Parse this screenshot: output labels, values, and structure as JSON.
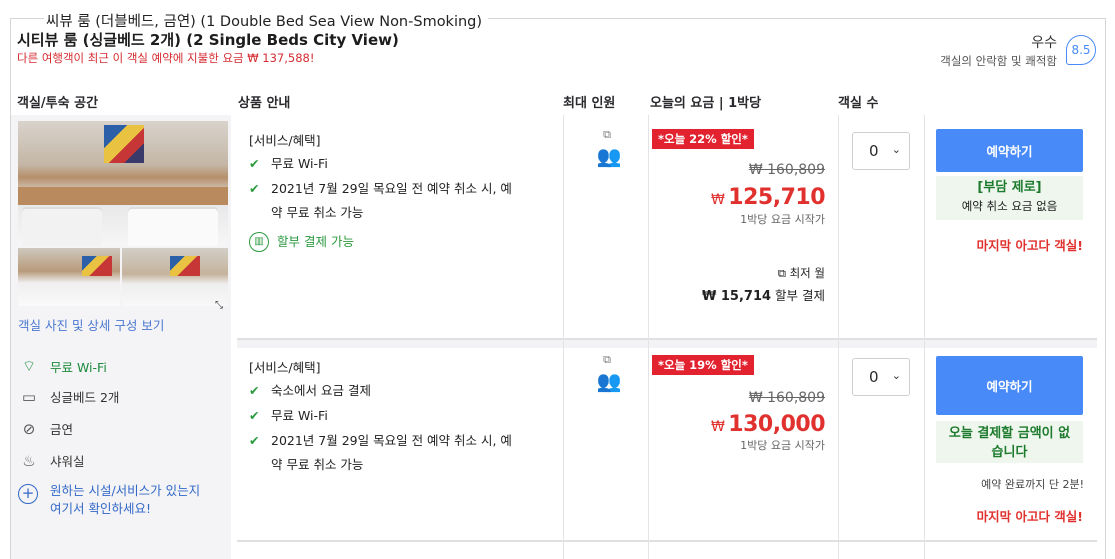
{
  "prev_room_title": "씨뷰 룸 (더블베드, 금연) (1 Double Bed Sea View Non-Smoking)",
  "room": {
    "title": "시티뷰 룸 (싱글베드 2개) (2 Single Beds City View)",
    "warning": "다른 여행객이 최근 이 객실 예약에 지불한 요금 ₩ 137,588!",
    "rating": {
      "word": "우수",
      "sub": "객실의 안락함 및 쾌적함",
      "score": "8.5"
    }
  },
  "headers": {
    "room_space": "객실/투숙 공간",
    "product": "상품 안내",
    "max_guests": "최대 인원",
    "price": "오늘의 요금 | 1박당",
    "rooms": "객실 수"
  },
  "left": {
    "photo_link": "객실 사진 및 상세 구성 보기",
    "amenities": [
      {
        "icon": "wifi-icon",
        "label": "무료 Wi-Fi"
      },
      {
        "icon": "bed-icon",
        "label": "싱글베드 2개"
      },
      {
        "icon": "no-smoking-icon",
        "label": "금연"
      },
      {
        "icon": "shower-icon",
        "label": "샤워실"
      }
    ],
    "more_line1": "원하는 시설/서비스가 있는지",
    "more_line2": "여기서 확인하세요!"
  },
  "offers": [
    {
      "header": "[서비스/혜택]",
      "items": [
        "무료 Wi-Fi",
        "2021년 7월 29일 목요일 전 예약 취소 시, 예약 무료 취소 가능"
      ],
      "installment": "할부 결제 가능",
      "discount_badge": "*오늘 22% 할인*",
      "original_price": "₩ 160,809",
      "currency": "₩",
      "price": "125,710",
      "per_night": "1박당 요금 시작가",
      "min_label": "최저 월",
      "installment_price": "₩ 15,714",
      "installment_suffix": "할부 결제",
      "qty": "0",
      "book_label": "예약하기",
      "green_title": "[부담 제로]",
      "green_sub": "예약 취소 요금 없음",
      "last": "마지막 아고다 객실!"
    },
    {
      "header": "[서비스/혜택]",
      "items": [
        "숙소에서 요금 결제",
        "무료 Wi-Fi",
        "2021년 7월 29일 목요일 전 예약 취소 시, 예약 무료 취소 가능"
      ],
      "discount_badge": "*오늘 19% 할인*",
      "original_price": "₩ 160,809",
      "currency": "₩",
      "price": "130,000",
      "per_night": "1박당 요금 시작가",
      "qty": "0",
      "book_label": "예약하기",
      "green_title": "오늘 결제할 금액이 없습니다",
      "note": "예약 완료까지 단 2분!",
      "last": "마지막 아고다 객실!"
    }
  ]
}
